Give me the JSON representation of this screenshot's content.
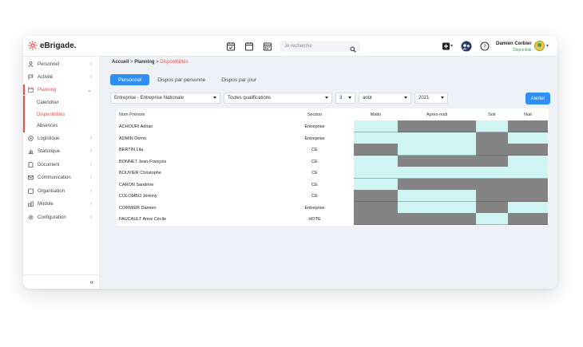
{
  "app": {
    "brand": "eBrigade."
  },
  "topbar": {
    "search_placeholder": "Je recherche",
    "user_name": "Damien Corbier",
    "user_status": "Disponible"
  },
  "sidebar": {
    "items": [
      {
        "label": "Personnel",
        "icon": "person-icon"
      },
      {
        "label": "Activité",
        "icon": "flag-icon"
      },
      {
        "label": "Planning",
        "icon": "calendar-icon"
      },
      {
        "label": "Logistique",
        "icon": "gear-icon"
      },
      {
        "label": "Statistique",
        "icon": "bar-chart-icon"
      },
      {
        "label": "Document",
        "icon": "document-icon"
      },
      {
        "label": "Communication",
        "icon": "mail-icon"
      },
      {
        "label": "Organisation",
        "icon": "folder-icon"
      },
      {
        "label": "Module",
        "icon": "module-icon"
      },
      {
        "label": "Configuration",
        "icon": "settings-icon"
      }
    ],
    "sub_items": [
      "Calendrier",
      "Disponibilités",
      "Absences"
    ],
    "collapse": "«"
  },
  "breadcrumb": {
    "a": "Accueil",
    "b": "Planning",
    "c": "Disponibilités",
    "sep": ">"
  },
  "tabs": [
    "Personnel",
    "Dispos par personne",
    "Dispos par jour"
  ],
  "filters": {
    "entity": "Entreprise - Entreprise Nationale",
    "qualification": "Toutes qualifications",
    "day": "3",
    "month": "août",
    "year": "2021",
    "alert_button": "Alerter"
  },
  "table": {
    "headers": [
      "Nom Prénom",
      "Section",
      "Matin",
      "Après-midi",
      "Soir",
      "Nuit"
    ],
    "rows": [
      {
        "name": "ACHOURI Adrian",
        "section": "Entreprise",
        "slots": [
          1,
          0,
          1,
          0
        ]
      },
      {
        "name": "ADMIN Demo",
        "section": "Entreprise",
        "slots": [
          1,
          1,
          0,
          1
        ]
      },
      {
        "name": "BERTIN Lila",
        "section": "CE",
        "slots": [
          0,
          1,
          0,
          0
        ]
      },
      {
        "name": "BONNET Jean-François",
        "section": "CE",
        "slots": [
          1,
          0,
          0,
          1
        ]
      },
      {
        "name": "BOUVIER Christophe",
        "section": "CE",
        "slots": [
          1,
          1,
          1,
          1
        ]
      },
      {
        "name": "CARON Sandrine",
        "section": "CE",
        "slots": [
          1,
          0,
          0,
          0
        ]
      },
      {
        "name": "COLOMBO Jérémy",
        "section": "CE",
        "slots": [
          0,
          1,
          0,
          0
        ]
      },
      {
        "name": "CORMIER Damien",
        "section": "Entreprise",
        "slots": [
          0,
          1,
          0,
          1
        ]
      },
      {
        "name": "FAUCAULT Anne Cécile",
        "section": "HOTE",
        "slots": [
          0,
          0,
          1,
          0
        ]
      }
    ]
  },
  "colors": {
    "accent": "#2f8ff5",
    "brand": "#e0524f",
    "available": "#cef5f3",
    "unavailable": "#848484"
  }
}
